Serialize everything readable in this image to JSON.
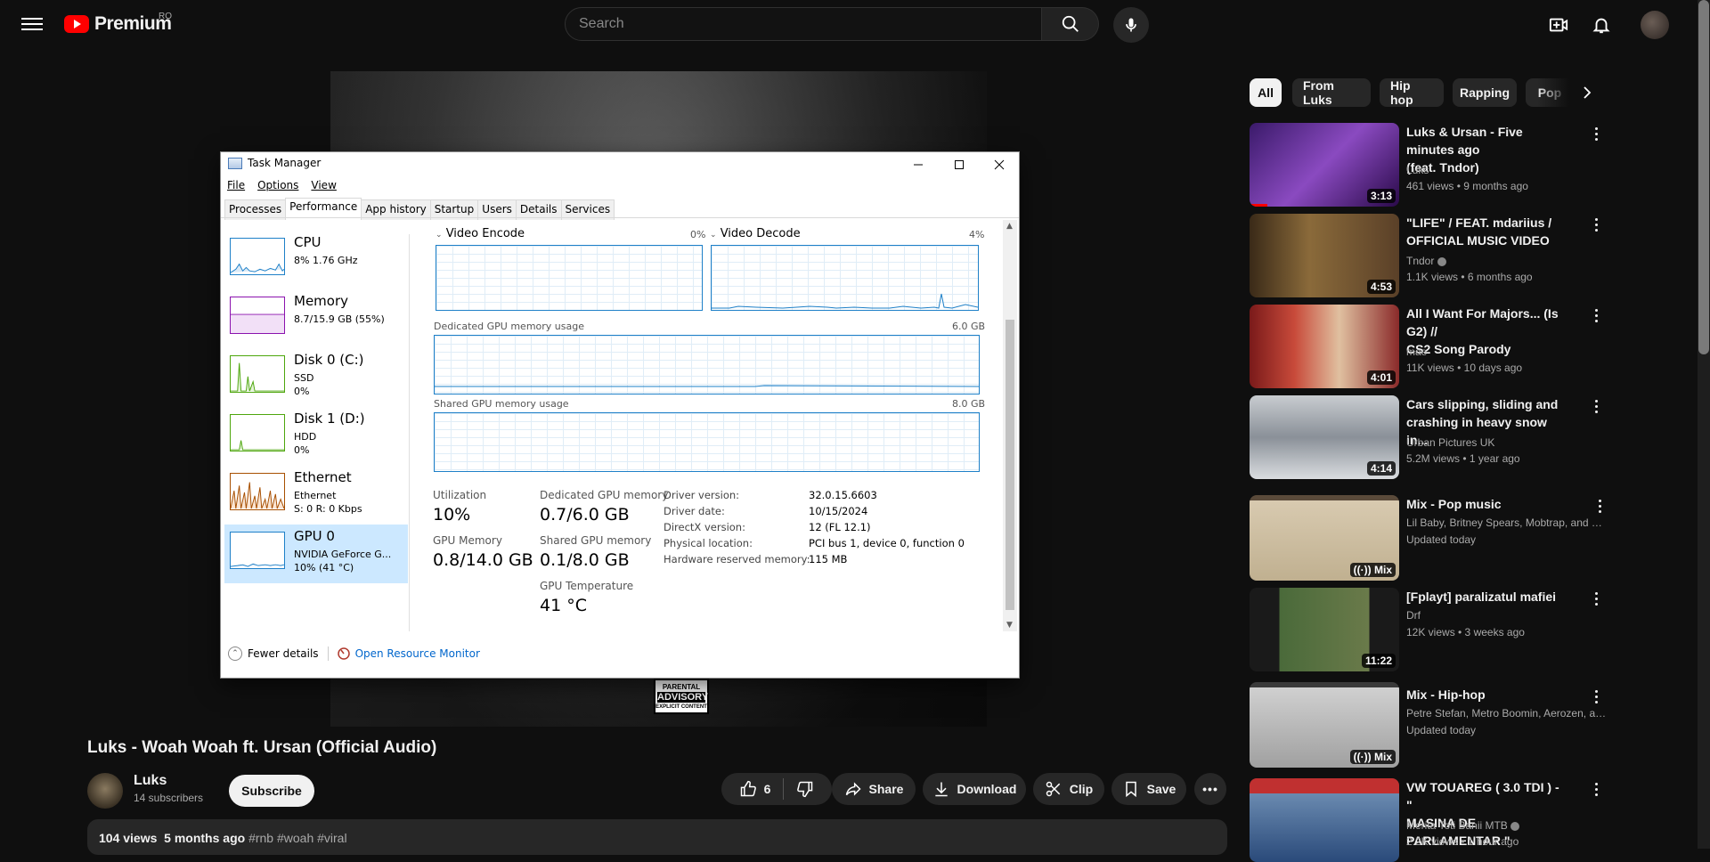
{
  "header": {
    "logo_text": "Premium",
    "country_code": "RO",
    "search_placeholder": "Search"
  },
  "video": {
    "title": "Luks - Woah Woah ft. Ursan (Official Audio)",
    "advisory_line1": "PARENTAL",
    "advisory_line2": "ADVISORY",
    "advisory_line3": "EXPLICIT CONTENT"
  },
  "channel": {
    "name": "Luks",
    "subscribers": "14 subscribers",
    "subscribe_label": "Subscribe"
  },
  "actions": {
    "likes": "6",
    "share": "Share",
    "download": "Download",
    "clip": "Clip",
    "save": "Save"
  },
  "description": {
    "stats": "104 views  5 months ago",
    "tags": "#rnb #woah #viral"
  },
  "chips": [
    "All",
    "From Luks",
    "Hip hop",
    "Rapping",
    "Pop"
  ],
  "recommendations": [
    {
      "title_line1": "Luks & Ursan - Five minutes ago",
      "title_line2": "(feat. Tndor)",
      "channel": "Luks",
      "meta": "461 views • 9 months ago",
      "duration": "3:13",
      "thumb_color": "#5a2a8a"
    },
    {
      "title_line1": "\"LIFE\" / FEAT. mdariius /",
      "title_line2": "OFFICIAL MUSIC VIDEO",
      "channel": "Tndor",
      "meta": "1.1K views • 6 months ago",
      "duration": "4:53",
      "thumb_color": "#6b4a2a"
    },
    {
      "title_line1": "All I Want For Majors... (Is G2) //",
      "title_line2": "CS2 Song Parody",
      "channel": "mae",
      "meta": "11K views • 10 days ago",
      "duration": "4:01",
      "thumb_color": "#8a2a2a"
    },
    {
      "title_line1": "Cars slipping, sliding and",
      "title_line2": "crashing in heavy snow in...",
      "channel": "Urban Pictures UK",
      "meta": "5.2M views • 1 year ago",
      "duration": "4:14",
      "thumb_color": "#9aa4ac"
    },
    {
      "title_line1": "Mix - Pop music",
      "title_line2": "",
      "channel": "Lil Baby, Britney Spears, Mobtrap, and m...",
      "meta": "Updated today",
      "duration": "Mix",
      "thumb_color": "#c8b8a0"
    },
    {
      "title_line1": "[Fplayt] paralizatul mafiei",
      "title_line2": "",
      "channel": "Drf",
      "meta": "12K views • 3 weeks ago",
      "duration": "11:22",
      "thumb_color": "#4a6a3a"
    },
    {
      "title_line1": "Mix - Hip-hop",
      "title_line2": "",
      "channel": "Petre Stefan, Metro Boomin, Aerozen, an...",
      "meta": "Updated today",
      "duration": "Mix",
      "thumb_color": "#b8b8b8"
    },
    {
      "title_line1": "VW TOUAREG ( 3.0 TDI ) - \"",
      "title_line2": "MASINA DE PARLAMENTAR \"",
      "channel": "Merita Toti Banii MTB",
      "meta": "2.2K views • 1 hour ago",
      "duration": "",
      "thumb_color": "#3a5a8a"
    }
  ],
  "task_manager": {
    "title": "Task Manager",
    "menu": [
      "File",
      "Options",
      "View"
    ],
    "tabs": [
      "Processes",
      "Performance",
      "App history",
      "Startup",
      "Users",
      "Details",
      "Services"
    ],
    "sidebar": [
      {
        "name": "CPU",
        "line1": "8%  1.76 GHz",
        "line2": "",
        "line3": ""
      },
      {
        "name": "Memory",
        "line1": "8.7/15.9 GB (55%)",
        "line2": "",
        "line3": ""
      },
      {
        "name": "Disk 0 (C:)",
        "line1": "SSD",
        "line2": "0%",
        "line3": ""
      },
      {
        "name": "Disk 1 (D:)",
        "line1": "HDD",
        "line2": "0%",
        "line3": ""
      },
      {
        "name": "Ethernet",
        "line1": "Ethernet",
        "line2": "S: 0  R: 0 Kbps",
        "line3": ""
      },
      {
        "name": "GPU 0",
        "line1": "NVIDIA GeForce G...",
        "line2": "10%  (41 °C)",
        "line3": ""
      }
    ],
    "graphs": {
      "video_encode": "Video Encode",
      "video_encode_pct": "0%",
      "video_decode": "Video Decode",
      "video_decode_pct": "4%",
      "dedicated_label": "Dedicated GPU memory usage",
      "dedicated_max": "6.0 GB",
      "shared_label": "Shared GPU memory usage",
      "shared_max": "8.0 GB"
    },
    "stats": {
      "utilization_label": "Utilization",
      "utilization": "10%",
      "dedicated_label": "Dedicated GPU memory",
      "dedicated": "0.7/6.0 GB",
      "gpu_memory_label": "GPU Memory",
      "gpu_memory": "0.8/14.0 GB",
      "shared_label": "Shared GPU memory",
      "shared": "0.1/8.0 GB",
      "temp_label": "GPU Temperature",
      "temp": "41 °C"
    },
    "details": [
      {
        "label": "Driver version:",
        "value": "32.0.15.6603"
      },
      {
        "label": "Driver date:",
        "value": "10/15/2024"
      },
      {
        "label": "DirectX version:",
        "value": "12 (FL 12.1)"
      },
      {
        "label": "Physical location:",
        "value": "PCI bus 1, device 0, function 0"
      },
      {
        "label": "Hardware reserved memory:",
        "value": "115 MB"
      }
    ],
    "footer": {
      "fewer_details": "Fewer details",
      "open_monitor": "Open Resource Monitor"
    }
  }
}
